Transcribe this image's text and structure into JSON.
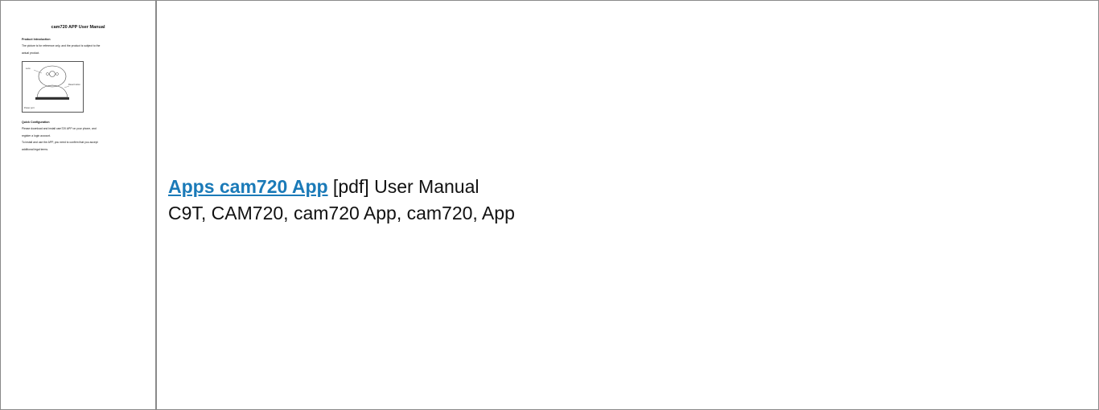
{
  "thumbnail": {
    "title": "cam720 APP User Manual",
    "section1_heading": "Product Introduction",
    "section1_lines": [
      "The picture is for reference only, and the product is subject to the",
      "actual product."
    ],
    "figure_labels": {
      "lens": "Lens",
      "reset": "Reset button",
      "power": "Power port"
    },
    "section2_heading": "Quick Configuration",
    "section2_lines": [
      "Please download and install cam720 APP on your phone, and",
      "register a login account.",
      "To install and use the APP, you need to confirm that you accept",
      "additional legal terms."
    ]
  },
  "main": {
    "link_text": "Apps cam720 App",
    "after_link_text": " [pdf] User Manual",
    "tags_text": "C9T, CAM720, cam720 App, cam720, App"
  },
  "colors": {
    "link": "#1a7ab8",
    "border": "#8a8a8a"
  }
}
